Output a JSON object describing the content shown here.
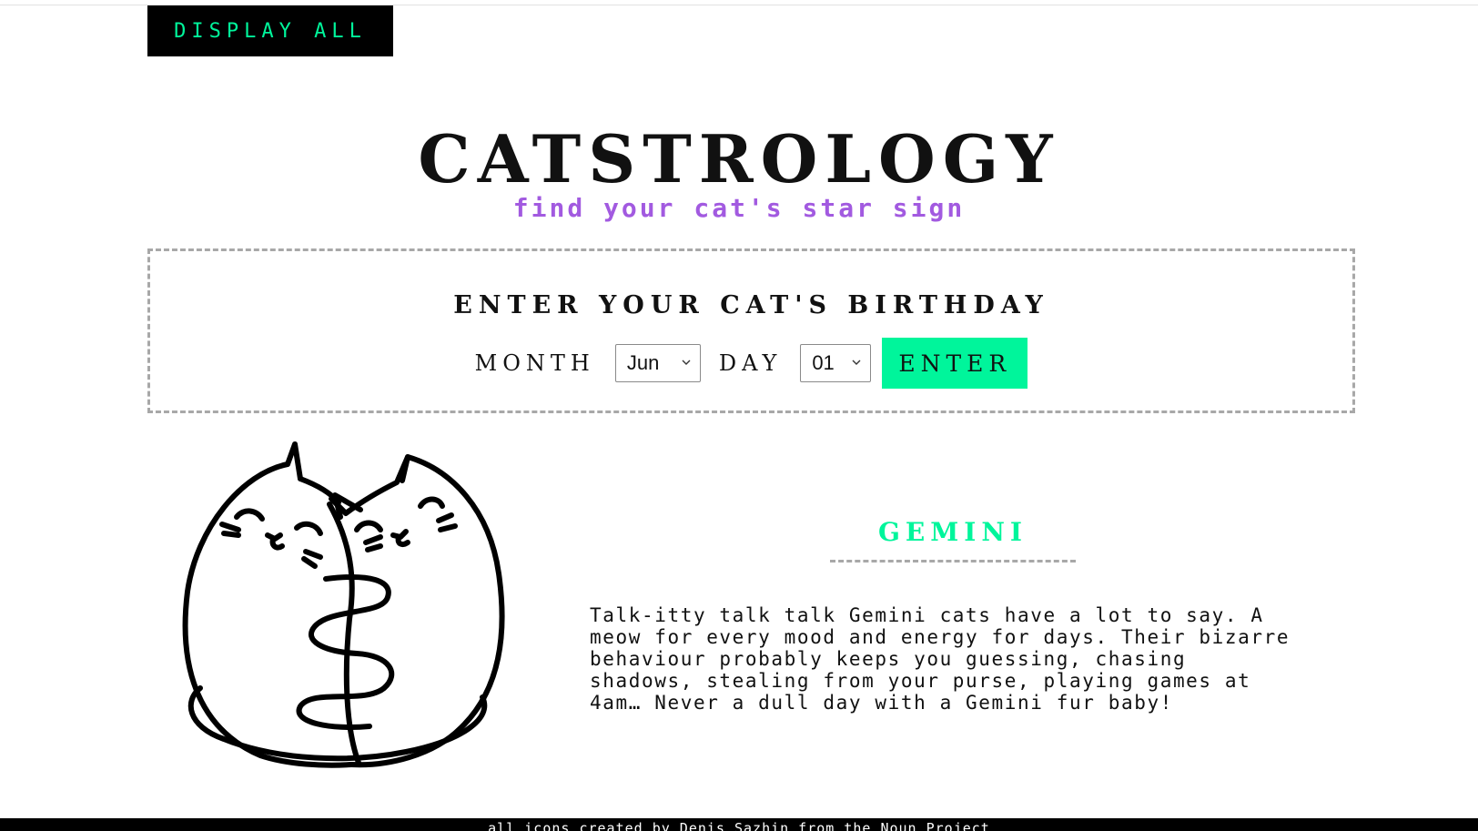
{
  "header": {
    "display_all_label": "DISPLAY ALL"
  },
  "hero": {
    "title": "CATSTROLOGY",
    "subtitle": "find your cat's star sign"
  },
  "birthday_form": {
    "heading": "ENTER YOUR CAT'S BIRTHDAY",
    "month_label": "MONTH",
    "month_value": "Jun",
    "day_label": "DAY",
    "day_value": "01",
    "enter_label": "ENTER"
  },
  "result": {
    "icon": "gemini-twin-cats-icon",
    "sign_name": "GEMINI",
    "description": "Talk-itty talk talk Gemini cats have a lot to say. A meow for every mood and energy for days. Their bizarre behaviour probably keeps you guessing, chasing shadows, stealing from your purse, playing games at 4am… Never a dull day with a Gemini fur baby!"
  },
  "footer": {
    "credit": "all icons created by Denis Sazhin from the Noun Project"
  },
  "colors": {
    "accent_green": "#00f59b",
    "accent_purple": "#a25ae0",
    "dashed_border": "#a8a8a8",
    "black": "#000000"
  }
}
